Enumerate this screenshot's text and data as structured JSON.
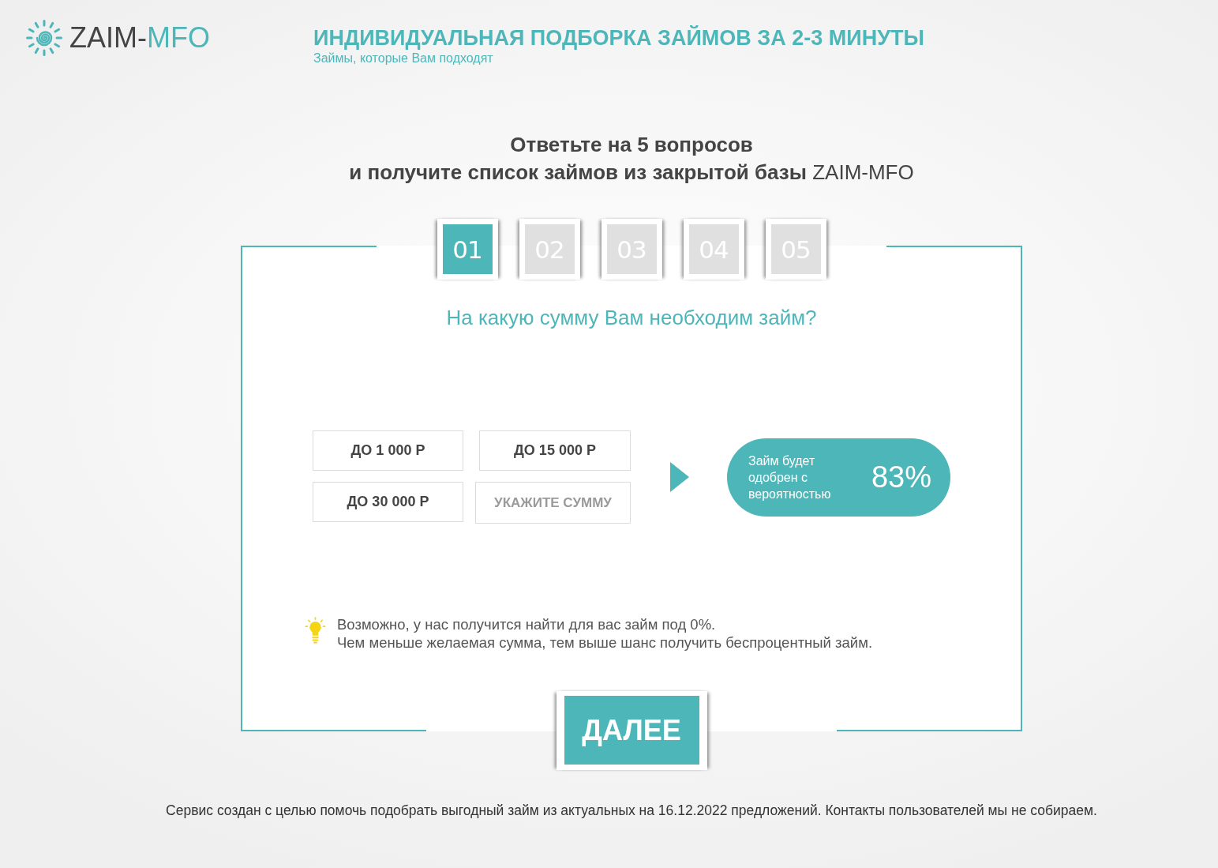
{
  "header": {
    "logo": {
      "prefix": "ZAIM-",
      "accent": "MFO"
    },
    "title": "ИНДИВИДУАЛЬНАЯ ПОДБОРКА ЗАЙМОВ ЗА 2-3 МИНУТЫ",
    "subtitle": "Займы, которые Вам подходят"
  },
  "intro": {
    "title": "Ответьте на 5 вопросов",
    "subtitle": "**и получите список займов из закрытой базы** ZAIM-MFO"
  },
  "card": {
    "steps": [
      {
        "label": "01",
        "selected": true
      },
      {
        "label": "02",
        "selected": false
      },
      {
        "label": "03",
        "selected": false
      },
      {
        "label": "04",
        "selected": false
      },
      {
        "label": "05",
        "selected": false
      }
    ],
    "question": "На какую сумму Вам необходим займ?",
    "options": [
      {
        "label": "ДО 1 000 Р",
        "selected": false
      },
      {
        "label": "ДО 15 000 Р",
        "selected": false
      },
      {
        "label": "ДО 30 000 Р",
        "selected": false
      }
    ],
    "amount_field": {
      "placeholder": "УКАЖИТЕ СУММУ"
    },
    "approval": {
      "label": "Займ будет одобрен с вероятностью",
      "value": "83%"
    },
    "hint": {
      "lines": [
        "Возможно, у нас получится найти для вас займ под 0%.",
        "Чем меньше желаемая сумма, тем выше шанс получить беспроцентный займ."
      ]
    },
    "next_button": "ДАЛЕЕ"
  },
  "footer": "Сервис создан с целью помочь подобрать выгодный займ из актуальных на 16.12.2022 предложений. Контакты пользователей мы не собираем."
}
